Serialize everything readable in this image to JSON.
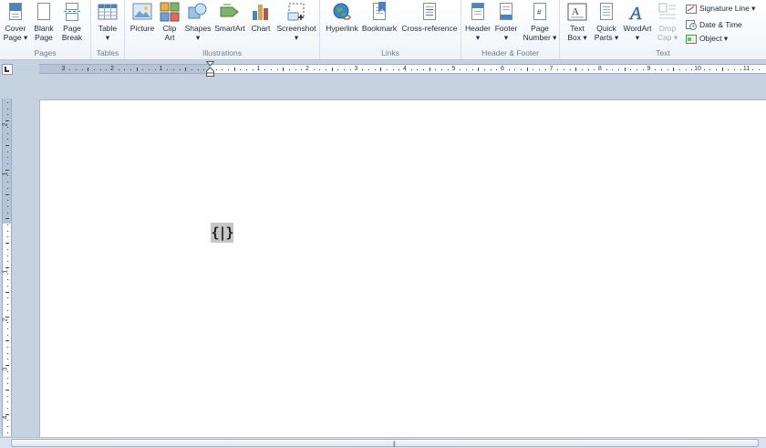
{
  "ribbon": {
    "pages": {
      "label": "Pages",
      "cover_page": [
        "Cover",
        "Page ▾"
      ],
      "blank_page": [
        "Blank",
        "Page"
      ],
      "page_break": [
        "Page",
        "Break"
      ]
    },
    "tables": {
      "label": "Tables",
      "table": [
        "Table",
        "▾"
      ]
    },
    "illustrations": {
      "label": "Illustrations",
      "picture": "Picture",
      "clip_art": [
        "Clip",
        "Art"
      ],
      "shapes": [
        "Shapes",
        "▾"
      ],
      "smartart": "SmartArt",
      "chart": "Chart",
      "screenshot": [
        "Screenshot",
        "▾"
      ]
    },
    "links": {
      "label": "Links",
      "hyperlink": "Hyperlink",
      "bookmark": "Bookmark",
      "cross_reference": "Cross-reference"
    },
    "header_footer": {
      "label": "Header & Footer",
      "header": [
        "Header",
        "▾"
      ],
      "footer": [
        "Footer",
        "▾"
      ],
      "page_number": [
        "Page",
        "Number ▾"
      ]
    },
    "text": {
      "label": "Text",
      "text_box": [
        "Text",
        "Box ▾"
      ],
      "quick_parts": [
        "Quick",
        "Parts ▾"
      ],
      "wordart": [
        "WordArt",
        "▾"
      ],
      "drop_cap": [
        "Drop",
        "Cap ▾"
      ],
      "signature_line": "Signature Line ▾",
      "date_time": "Date & Time",
      "object": "Object ▾"
    }
  },
  "ruler": {
    "h_labels_left": [
      "3",
      "2",
      "1"
    ],
    "h_labels_right": [
      "1",
      "2",
      "3",
      "4",
      "5",
      "6",
      "7",
      "8",
      "9",
      "10",
      "11"
    ],
    "v_labels": [
      "2",
      "1",
      "1",
      "2",
      "3",
      "4"
    ]
  },
  "document": {
    "field_code": "{|}"
  },
  "colors": {
    "ribbon_bg": "#f7f9fc",
    "workspace_bg": "#c7d2e0",
    "field_shading": "#c6c6c6"
  }
}
